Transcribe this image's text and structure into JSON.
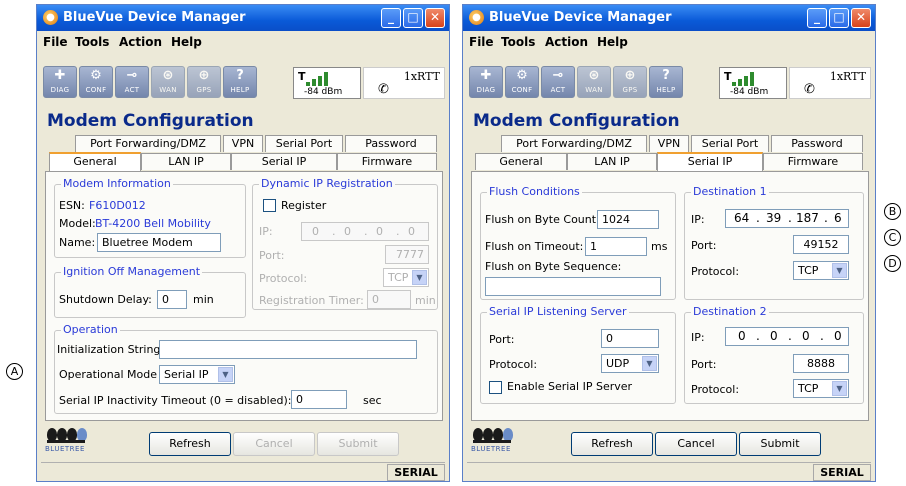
{
  "app_title": "BlueVue Device Manager",
  "menu": [
    "File",
    "Tools",
    "Action",
    "Help"
  ],
  "toolbar": [
    "DIAG",
    "CONF",
    "ACT",
    "WAN",
    "GPS",
    "HELP"
  ],
  "signal": {
    "dbm": "-84 dBm",
    "network": "1xRTT"
  },
  "heading": "Modem Configuration",
  "tabs_top": [
    "Port Forwarding/DMZ",
    "VPN",
    "Serial Port",
    "Password"
  ],
  "tabs_bottom": [
    "General",
    "LAN IP",
    "Serial IP",
    "Firmware"
  ],
  "buttons": {
    "refresh": "Refresh",
    "cancel": "Cancel",
    "submit": "Submit"
  },
  "logo_text": "BLUETREE",
  "status": "SERIAL",
  "callouts": [
    "A",
    "B",
    "C",
    "D"
  ],
  "left": {
    "selected_tab": "General",
    "modem_info": {
      "title": "Modem Information",
      "esn_label": "ESN:",
      "esn": "F610D012",
      "model_label": "Model:",
      "model": "BT-4200 Bell Mobility",
      "name_label": "Name:",
      "name": "Bluetree Modem"
    },
    "dyn_ip": {
      "title": "Dynamic IP Registration",
      "register": "Register",
      "ip_label": "IP:",
      "ip": [
        "0",
        "0",
        "0",
        "0"
      ],
      "port_label": "Port:",
      "port": "7777",
      "protocol_label": "Protocol:",
      "protocol": "TCP",
      "timer_label": "Registration Timer:",
      "timer": "0",
      "timer_unit": "min"
    },
    "ignition": {
      "title": "Ignition Off Management",
      "delay_label": "Shutdown Delay:",
      "delay": "0",
      "delay_unit": "min"
    },
    "operation": {
      "title": "Operation",
      "init_label": "Initialization String:",
      "init": "",
      "mode_label": "Operational Mode",
      "mode": "Serial IP",
      "timeout_label": "Serial IP Inactivity Timeout (0 = disabled):",
      "timeout": "0",
      "timeout_unit": "sec"
    }
  },
  "right": {
    "selected_tab": "Serial IP",
    "flush": {
      "title": "Flush Conditions",
      "byte_count_label": "Flush on Byte Count:",
      "byte_count": "1024",
      "timeout_label": "Flush on Timeout:",
      "timeout": "1",
      "timeout_unit": "ms",
      "sequence_label": "Flush on Byte Sequence:",
      "sequence": ""
    },
    "dest1": {
      "title": "Destination 1",
      "ip_label": "IP:",
      "ip": [
        "64",
        "39",
        "187",
        "6"
      ],
      "port_label": "Port:",
      "port": "49152",
      "protocol_label": "Protocol:",
      "protocol": "TCP"
    },
    "listen": {
      "title": "Serial IP Listening Server",
      "port_label": "Port:",
      "port": "0",
      "protocol_label": "Protocol:",
      "protocol": "UDP",
      "enable": "Enable Serial IP Server"
    },
    "dest2": {
      "title": "Destination 2",
      "ip_label": "IP:",
      "ip": [
        "0",
        "0",
        "0",
        "0"
      ],
      "port_label": "Port:",
      "port": "8888",
      "protocol_label": "Protocol:",
      "protocol": "TCP"
    }
  }
}
